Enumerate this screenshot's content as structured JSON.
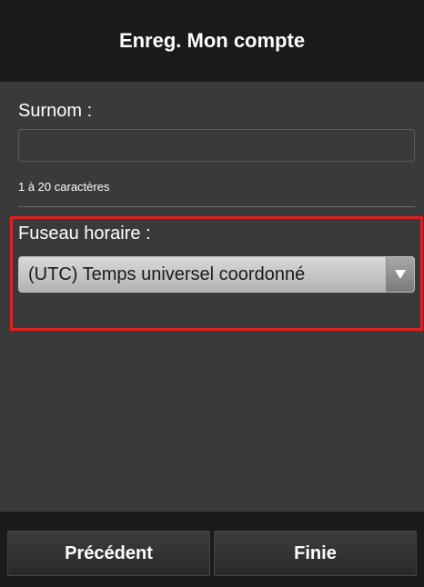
{
  "header": {
    "title": "Enreg. Mon compte"
  },
  "nickname": {
    "label": "Surnom :",
    "value": "",
    "hint": "1 à 20 caractères"
  },
  "timezone": {
    "label": "Fuseau horaire :",
    "selected": "(UTC) Temps universel coordonné",
    "highlight_color": "#e02020"
  },
  "footer": {
    "prev_label": "Précédent",
    "finish_label": "Finie"
  },
  "icons": {
    "dropdown": "chevron-down-icon"
  }
}
